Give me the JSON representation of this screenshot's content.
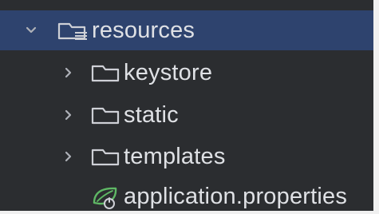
{
  "project_tree": {
    "colors": {
      "background": "#2b2d30",
      "selected_row": "#2e436e",
      "text": "#dfe1e5",
      "icon_stroke": "#ced0d6",
      "spring_green": "#5fb865"
    },
    "items": [
      {
        "label": "resources",
        "icon": "resources-folder-icon",
        "expanded": true,
        "selected": true
      },
      {
        "label": "keystore",
        "icon": "folder-icon",
        "expanded": false,
        "selected": false
      },
      {
        "label": "static",
        "icon": "folder-icon",
        "expanded": false,
        "selected": false
      },
      {
        "label": "templates",
        "icon": "folder-icon",
        "expanded": false,
        "selected": false
      },
      {
        "label": "application.properties",
        "icon": "spring-properties-icon",
        "selected": false
      }
    ]
  }
}
